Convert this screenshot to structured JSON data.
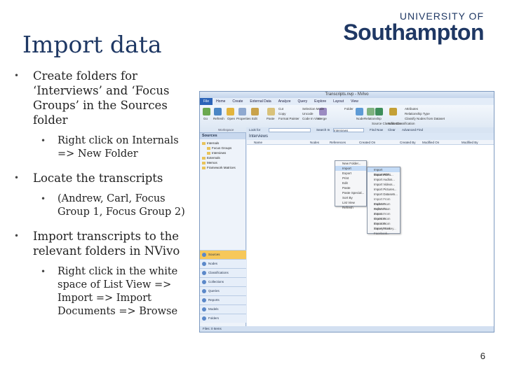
{
  "slide": {
    "title": "Import data",
    "logo_top": "UNIVERSITY OF",
    "logo_name": "Southampton",
    "page_number": "6"
  },
  "bullets": {
    "b1": "Create folders for ‘Interviews’ and ‘Focus Groups’ in the Sources folder",
    "b1_sub": "Right click on Internals => New Folder",
    "b2": "Locate the transcripts",
    "b2_sub": "(Andrew, Carl, Focus Group 1, Focus Group 2)",
    "b3": "Import transcripts to the relevant folders in NVivo",
    "b3_sub": "Right click in the white space of List View => Import => Import Documents => Browse"
  },
  "app": {
    "window_title": "Transcripts.nvp - NVivo",
    "menu": [
      "File",
      "Home",
      "Create",
      "External Data",
      "Analyze",
      "Query",
      "Explore",
      "Layout",
      "View"
    ],
    "ribbon": {
      "buttons": [
        "Go",
        "Refresh",
        "Open",
        "Properties",
        "Edit",
        "Paste",
        "Merge",
        "Node",
        "Relationship",
        "Source Classification",
        "Node Classification"
      ],
      "small": [
        "Cut",
        "Copy",
        "Format Painter",
        "Selection Mode",
        "Uncode",
        "Code In Vivo",
        "Folder",
        "Relationship Type",
        "Attributes",
        "Classify Nodes from Dataset"
      ],
      "groups": [
        "Workspace",
        "Clipboard",
        "Format",
        "Paragraph",
        "Styles",
        "Editing"
      ]
    },
    "nav_header": "Sources",
    "tree": [
      "Internals",
      "Focus Groups",
      "Interviews",
      "Externals",
      "Memos",
      "Framework Matrices"
    ],
    "nav_buttons": [
      "Sources",
      "Nodes",
      "Classifications",
      "Collections",
      "Queries",
      "Reports",
      "Models",
      "Folders"
    ],
    "find": {
      "look_for_label": "Look for",
      "search_in_label": "Search In",
      "search_value": "Interviews",
      "find_now": "Find Now",
      "clear": "Clear",
      "advanced": "Advanced Find"
    },
    "list_title": "Interviews",
    "columns": [
      "Name",
      "Nodes",
      "References",
      "Created On",
      "Created By",
      "Modified On",
      "Modified By"
    ],
    "context_menu": [
      "New Folder...",
      "Import",
      "Export",
      "Print",
      "Edit",
      "Paste",
      "Paste Special...",
      "Sort By",
      "List View",
      "Refresh"
    ],
    "submenu": [
      "Import Documents...",
      "Import PDFs...",
      "Import Audios...",
      "Import Videos...",
      "Import Pictures...",
      "Import Datasets...",
      "Import From EndNote...",
      "Import From RefWorks...",
      "Import From Zotero...",
      "Import From OneNote...",
      "Import From Evernote...",
      "Import From SurveyMonkey...",
      "Import From Facebook..."
    ],
    "status": "Files: 0 Items"
  }
}
